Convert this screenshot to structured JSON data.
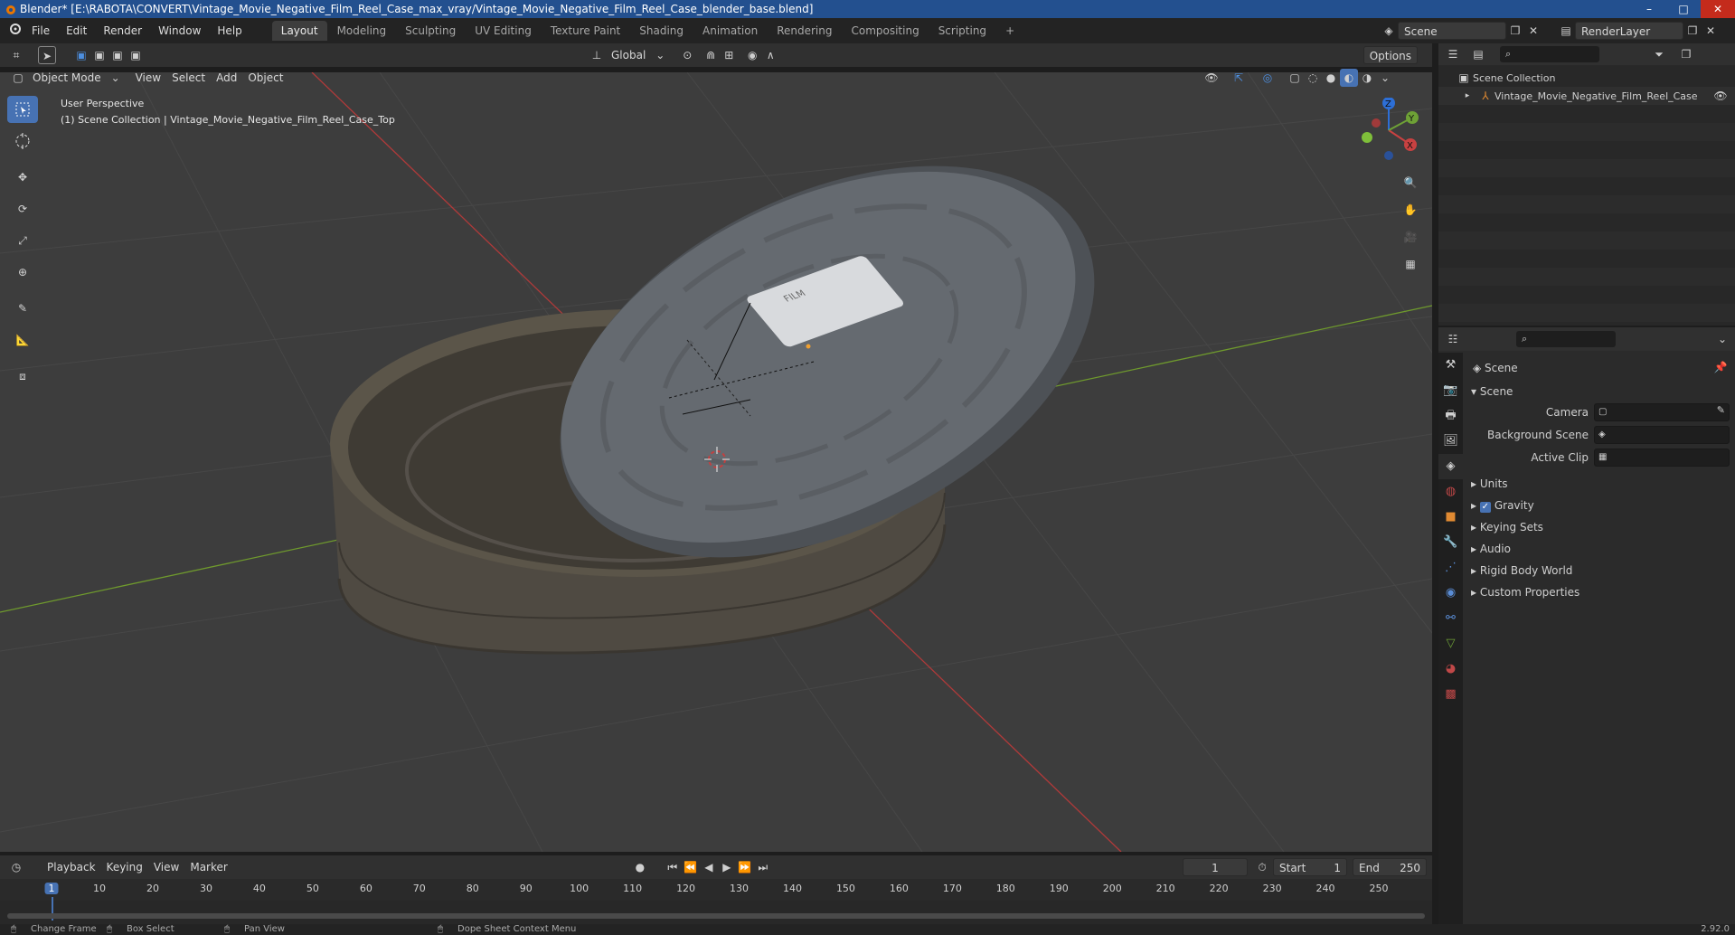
{
  "window": {
    "title": "Blender* [E:\\RABOTA\\CONVERT\\Vintage_Movie_Negative_Film_Reel_Case_max_vray/Vintage_Movie_Negative_Film_Reel_Case_blender_base.blend]",
    "controls": [
      "–",
      "□",
      "✕"
    ]
  },
  "menubar": {
    "items": [
      "File",
      "Edit",
      "Render",
      "Window",
      "Help"
    ],
    "workspaces": [
      "Layout",
      "Modeling",
      "Sculpting",
      "UV Editing",
      "Texture Paint",
      "Shading",
      "Animation",
      "Rendering",
      "Compositing",
      "Scripting"
    ],
    "active_workspace": "Layout",
    "add_tab": "+",
    "scene_label": "Scene",
    "renderlayer_label": "RenderLayer"
  },
  "viewport_header": {
    "transform_orientation": "Global",
    "options_label": "Options",
    "mode": "Object Mode",
    "menus": [
      "View",
      "Select",
      "Add",
      "Object"
    ]
  },
  "viewport": {
    "perspective_label": "User Perspective",
    "collection_label": "(1) Scene Collection | Vintage_Movie_Negative_Film_Reel_Case_Top",
    "label_text": "FILM",
    "gizmo": {
      "x": "X",
      "y": "Y",
      "z": "Z"
    }
  },
  "outliner": {
    "root": "Scene Collection",
    "items": [
      "Vintage_Movie_Negative_Film_Reel_Case"
    ]
  },
  "properties": {
    "context": "Scene",
    "section": "Scene",
    "fields": [
      {
        "label": "Camera",
        "value": ""
      },
      {
        "label": "Background Scene",
        "value": ""
      },
      {
        "label": "Active Clip",
        "value": ""
      }
    ],
    "panels": [
      "Units",
      "Gravity",
      "Keying Sets",
      "Audio",
      "Rigid Body World",
      "Custom Properties"
    ],
    "gravity_checked": true
  },
  "timeline": {
    "menus": [
      "Playback",
      "Keying",
      "View",
      "Marker"
    ],
    "current_frame": "1",
    "start_label": "Start",
    "start_value": "1",
    "end_label": "End",
    "end_value": "250",
    "ticks": [
      "1",
      "10",
      "20",
      "30",
      "40",
      "50",
      "60",
      "70",
      "80",
      "90",
      "100",
      "110",
      "120",
      "130",
      "140",
      "150",
      "160",
      "170",
      "180",
      "190",
      "200",
      "210",
      "220",
      "230",
      "240",
      "250"
    ]
  },
  "statusbar": {
    "items": [
      "Change Frame",
      "Box Select",
      "Pan View",
      "Dope Sheet Context Menu"
    ],
    "version": "2.92.0"
  },
  "colors": {
    "accent": "#4772b3",
    "titlebar": "#23508f",
    "viewport_bg": "#3d3d3d",
    "x_axis": "#b03a3a",
    "y_axis": "#6f9a2d"
  }
}
